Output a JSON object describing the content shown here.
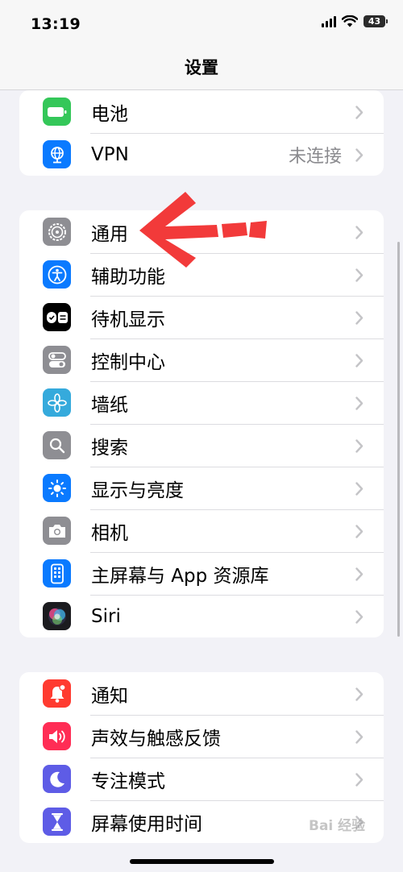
{
  "status_bar": {
    "time": "13:19",
    "battery_level": "43"
  },
  "nav": {
    "title": "设置"
  },
  "groups": [
    {
      "items": [
        {
          "label": "电池",
          "icon": "battery-icon",
          "color": "#34c759"
        },
        {
          "label": "VPN",
          "value": "未连接",
          "icon": "globe-network-icon",
          "color": "#0a7aff"
        }
      ]
    },
    {
      "items": [
        {
          "label": "通用",
          "icon": "gear-icon",
          "color": "#8e8e93"
        },
        {
          "label": "辅助功能",
          "icon": "accessibility-icon",
          "color": "#0a7aff"
        },
        {
          "label": "待机显示",
          "icon": "standby-icon",
          "color": "#000000"
        },
        {
          "label": "控制中心",
          "icon": "toggles-icon",
          "color": "#8e8e93"
        },
        {
          "label": "墙纸",
          "icon": "flower-icon",
          "color": "#35aadc"
        },
        {
          "label": "搜索",
          "icon": "search-icon",
          "color": "#8e8e93"
        },
        {
          "label": "显示与亮度",
          "icon": "sun-icon",
          "color": "#0a7aff"
        },
        {
          "label": "相机",
          "icon": "camera-icon",
          "color": "#8e8e93"
        },
        {
          "label": "主屏幕与 App 资源库",
          "icon": "home-screen-icon",
          "color": "#0a7aff"
        },
        {
          "label": "Siri",
          "icon": "siri-icon",
          "color": "#1b1b1f"
        }
      ]
    },
    {
      "items": [
        {
          "label": "通知",
          "icon": "bell-icon",
          "color": "#ff3b30"
        },
        {
          "label": "声效与触感反馈",
          "icon": "speaker-icon",
          "color": "#ff2d55"
        },
        {
          "label": "专注模式",
          "icon": "moon-icon",
          "color": "#5e5ce6"
        },
        {
          "label": "屏幕使用时间",
          "icon": "hourglass-icon",
          "color": "#5e5ce6"
        }
      ]
    }
  ],
  "watermark": "Bai 经验",
  "annotation_color": "#f23a3a"
}
